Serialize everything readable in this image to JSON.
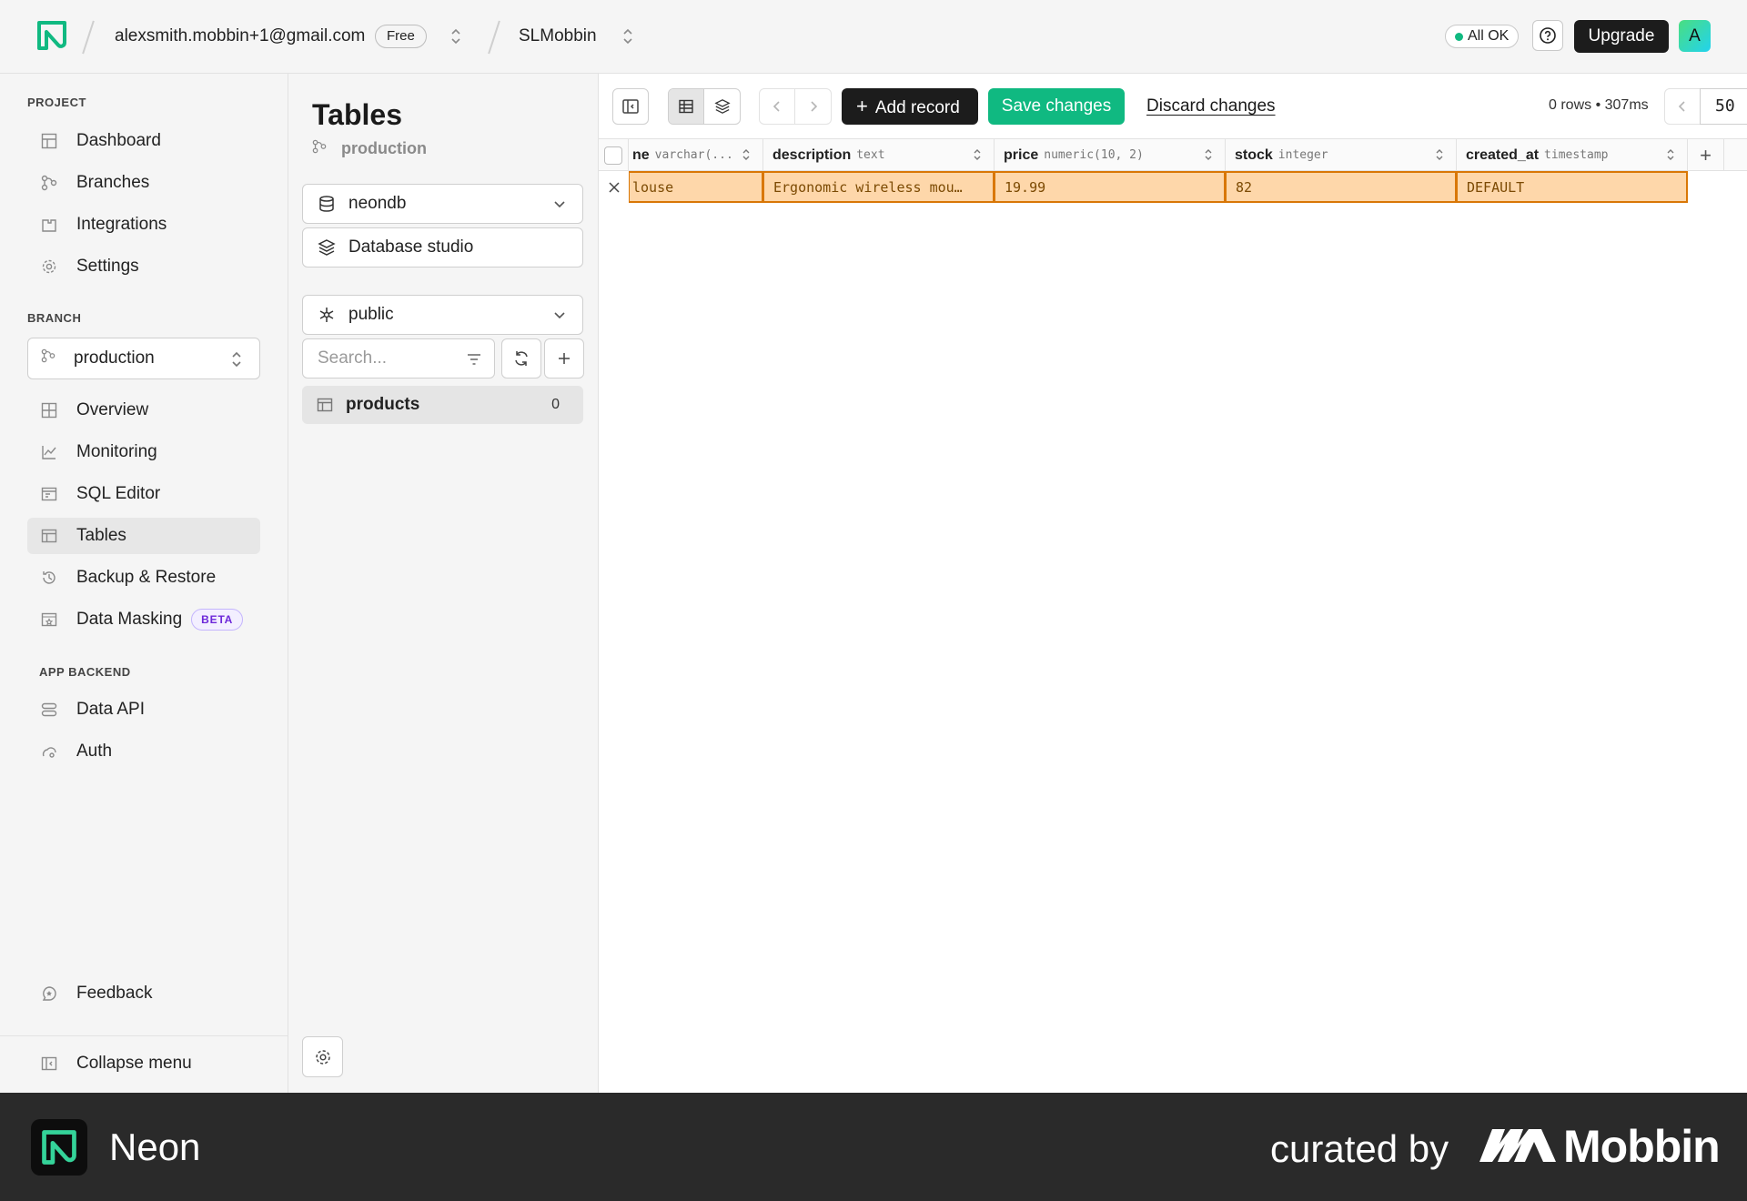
{
  "header": {
    "account_email": "alexsmith.mobbin+1@gmail.com",
    "plan": "Free",
    "project": "SLMobbin",
    "status": "All OK",
    "upgrade_label": "Upgrade",
    "avatar_initial": "A"
  },
  "leftnav": {
    "project_label": "PROJECT",
    "project_items": [
      {
        "label": "Dashboard",
        "icon": "dashboard-icon"
      },
      {
        "label": "Branches",
        "icon": "branches-icon"
      },
      {
        "label": "Integrations",
        "icon": "integrations-icon"
      },
      {
        "label": "Settings",
        "icon": "settings-icon"
      }
    ],
    "branch_label": "BRANCH",
    "branch_selected": "production",
    "branch_items": [
      {
        "label": "Overview",
        "icon": "overview-icon"
      },
      {
        "label": "Monitoring",
        "icon": "monitoring-icon"
      },
      {
        "label": "SQL Editor",
        "icon": "sql-editor-icon"
      },
      {
        "label": "Tables",
        "icon": "tables-icon",
        "active": true
      },
      {
        "label": "Backup & Restore",
        "icon": "backup-icon"
      },
      {
        "label": "Data Masking",
        "icon": "data-masking-icon",
        "badge": "BETA"
      }
    ],
    "app_backend_label": "APP BACKEND",
    "app_backend_items": [
      {
        "label": "Data API",
        "icon": "data-api-icon"
      },
      {
        "label": "Auth",
        "icon": "auth-icon"
      }
    ],
    "feedback_label": "Feedback",
    "collapse_label": "Collapse menu"
  },
  "tables_panel": {
    "title": "Tables",
    "branch": "production",
    "database": "neondb",
    "studio_label": "Database studio",
    "schema": "public",
    "search_placeholder": "Search...",
    "tables": [
      {
        "name": "products",
        "count": "0"
      }
    ]
  },
  "toolbar": {
    "add_record_label": "Add record",
    "save_label": "Save changes",
    "discard_label": "Discard changes",
    "rows_info": "0 rows • 307ms",
    "page_size": "50"
  },
  "grid": {
    "columns": [
      {
        "name": "ne",
        "type": "varchar(..."
      },
      {
        "name": "description",
        "type": "text"
      },
      {
        "name": "price",
        "type": "numeric(10, 2)"
      },
      {
        "name": "stock",
        "type": "integer"
      },
      {
        "name": "created_at",
        "type": "timestamp"
      }
    ],
    "new_row": [
      "louse",
      "Ergonomic wireless mou…",
      "19.99",
      "82",
      "DEFAULT"
    ]
  },
  "footer": {
    "brand": "Neon",
    "curated": "curated by",
    "curator": "Mobbin"
  },
  "colors": {
    "accent_green": "#10b981",
    "pending_row": "#fed7aa",
    "pending_border": "#d97706"
  }
}
